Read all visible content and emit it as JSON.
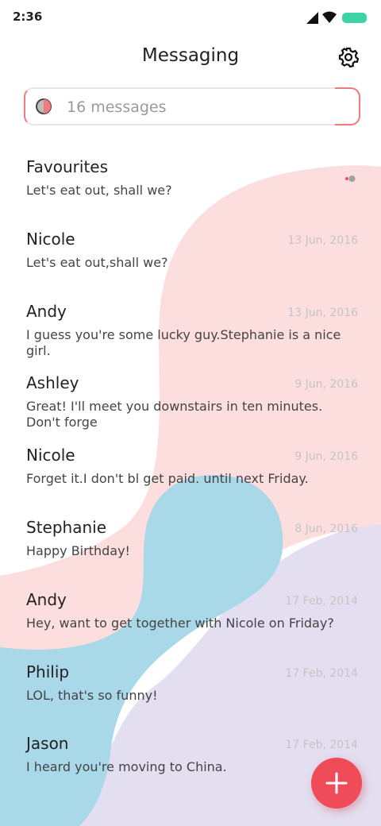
{
  "status_bar": {
    "time": "2:36",
    "icons": [
      "signal-icon",
      "wifi-icon",
      "battery-icon"
    ],
    "battery_color": "#3dd3a4"
  },
  "header": {
    "title": "Messaging",
    "settings_icon": "gear-icon"
  },
  "search": {
    "placeholder": "16 messages",
    "icon": "search-icon",
    "accent": "#f07a80"
  },
  "messages": [
    {
      "name": "Favourites",
      "date": "",
      "preview": "Let's eat out, shall we?",
      "unread": true
    },
    {
      "name": "Nicole",
      "date": "13 Jun, 2016",
      "preview": "Let's eat out,shall we?"
    },
    {
      "name": "Andy",
      "date": "13 Jun, 2016",
      "preview": "I guess you're some lucky guy.Stephanie is a nice girl."
    },
    {
      "name": "Ashley",
      "date": "9 Jun, 2016",
      "preview": "Great! I'll meet you downstairs in ten minutes. Don't forge"
    },
    {
      "name": "Nicole",
      "date": "9 Jun, 2016",
      "preview": "Forget it.I don't bl get paid. until next Friday."
    },
    {
      "name": "Stephanie",
      "date": "8 Jun, 2016",
      "preview": "Happy Birthday!"
    },
    {
      "name": "Andy",
      "date": "17 Feb, 2014",
      "preview": "Hey, want to get together with Nicole on Friday?"
    },
    {
      "name": "Philip",
      "date": "17 Feb, 2014",
      "preview": "LOL, that's so funny!"
    },
    {
      "name": "Jason",
      "date": "17 Feb, 2014",
      "preview": "I heard you're moving to China."
    }
  ],
  "fab": {
    "icon": "plus-icon",
    "color": "#ef4b58"
  },
  "colors": {
    "pink": "#fcdede",
    "blue": "#a9d8e8",
    "lavender": "#e3dff0"
  }
}
